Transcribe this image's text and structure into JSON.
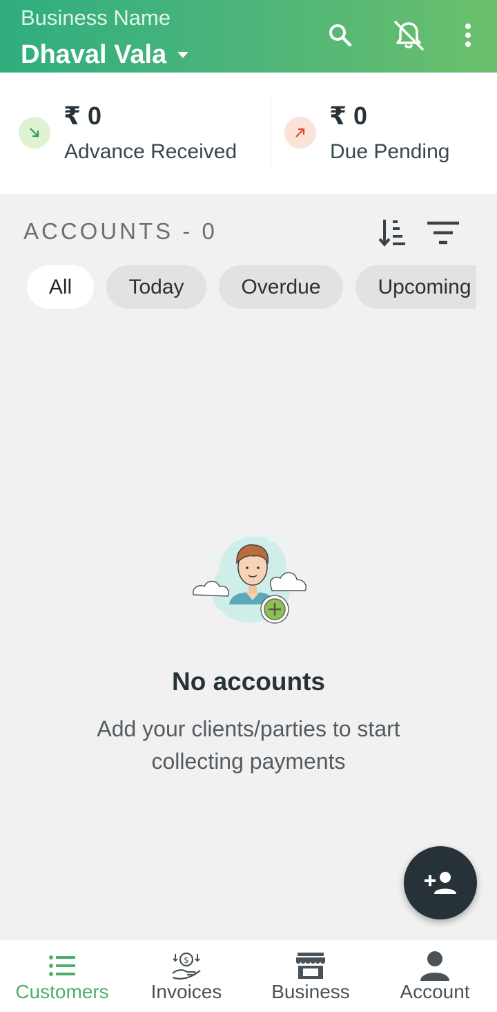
{
  "header": {
    "label": "Business Name",
    "business_name": "Dhaval Vala",
    "icons": [
      "search-icon",
      "notifications-off-icon",
      "more-vert-icon"
    ]
  },
  "summary": {
    "advance": {
      "amount": "₹ 0",
      "label": "Advance Received",
      "color": "#2e9e4f",
      "bg": "#dff3d3"
    },
    "due": {
      "amount": "₹ 0",
      "label": "Due Pending",
      "color": "#d84a2b",
      "bg": "#fbe3d9"
    }
  },
  "accounts": {
    "title": "ACCOUNTS - 0",
    "chips": [
      {
        "label": "All",
        "active": true
      },
      {
        "label": "Today",
        "active": false
      },
      {
        "label": "Overdue",
        "active": false
      },
      {
        "label": "Upcoming",
        "active": false
      }
    ]
  },
  "empty_state": {
    "title": "No accounts",
    "subtitle_line1": "Add your clients/parties to start",
    "subtitle_line2": "collecting payments"
  },
  "bottom_nav": {
    "items": [
      {
        "label": "Customers",
        "icon": "list-icon",
        "active": true
      },
      {
        "label": "Invoices",
        "icon": "money-hand-icon",
        "active": false
      },
      {
        "label": "Business",
        "icon": "store-icon",
        "active": false
      },
      {
        "label": "Account",
        "icon": "person-icon",
        "active": false
      }
    ]
  },
  "colors": {
    "header_start": "#2fae7e",
    "header_end": "#6bbf6b",
    "accent": "#4caf6e",
    "fab": "#263238"
  }
}
